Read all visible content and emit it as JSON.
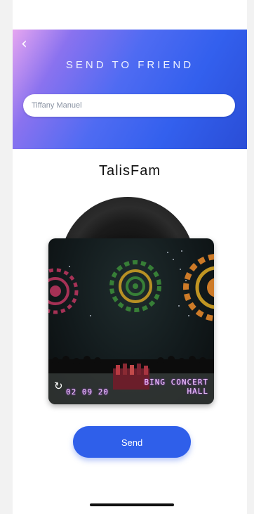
{
  "header": {
    "back_icon": "chevron-left-icon",
    "title": "SEND TO FRIEND",
    "recipient_value": "Tiffany Manuel"
  },
  "playlist": {
    "name": "TalisFam"
  },
  "photo": {
    "date_stamp": "02 09 20",
    "place_line1": "BING CONCERT",
    "place_line2": "HALL",
    "refresh_icon": "refresh-icon"
  },
  "actions": {
    "send_label": "Send"
  },
  "colors": {
    "accent": "#2f5fea",
    "header_gradient_start": "#e6a6f0",
    "header_gradient_end": "#2a4dd6"
  }
}
